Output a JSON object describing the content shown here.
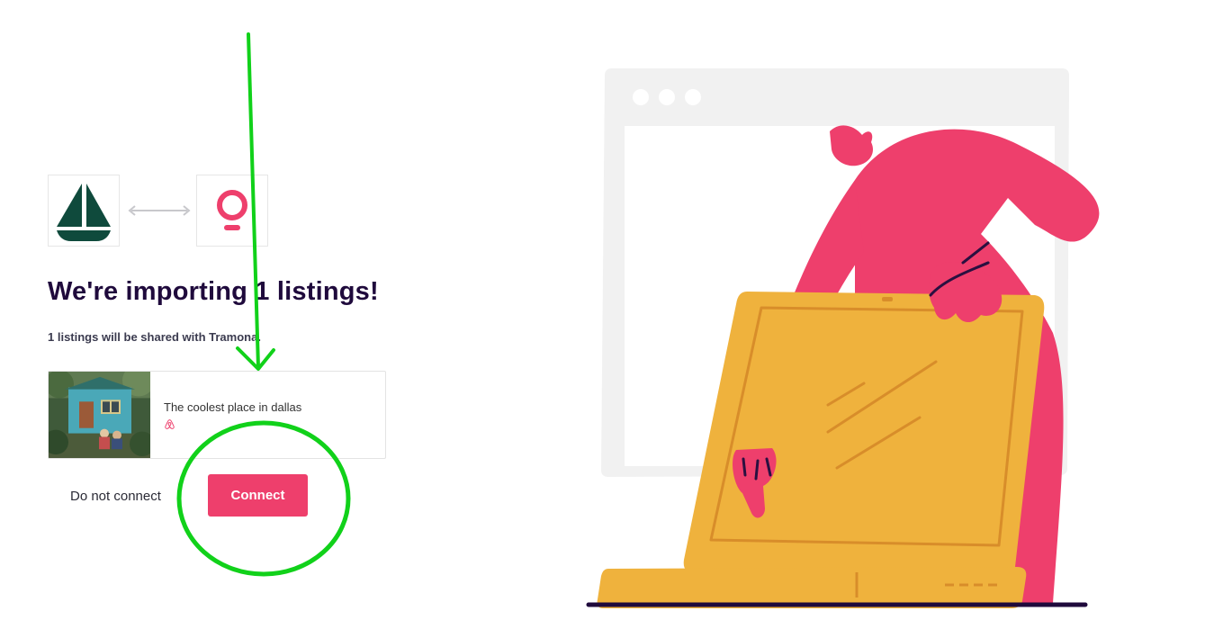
{
  "header": {
    "title": "We're importing 1 listings!",
    "subtitle": "1 listings will be shared with Tramona."
  },
  "listing": {
    "title": "The coolest place in dallas",
    "platform_icon": "airbnb-icon"
  },
  "actions": {
    "do_not_connect_label": "Do not connect",
    "connect_label": "Connect"
  },
  "integration": {
    "source_icon": "sailboat-logo",
    "target_icon": "tramona-logo",
    "link_icon": "swap-arrow-icon"
  },
  "colors": {
    "brand_accent": "#ee3f6c",
    "heading": "#1f0a3c",
    "sailboat": "#0f4a3c",
    "annotation": "#11d11a",
    "illustration_laptop": "#efb23d",
    "illustration_person": "#ee3f6c"
  }
}
